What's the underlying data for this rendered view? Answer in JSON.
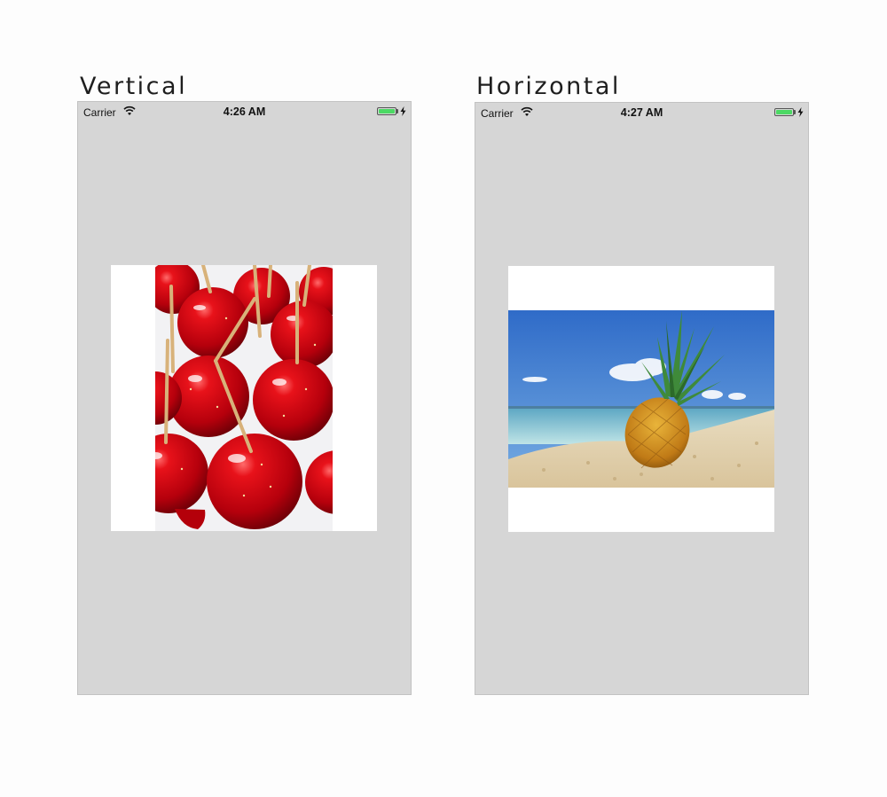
{
  "headings": {
    "vertical": "Vertical",
    "horizontal": "Horizontal"
  },
  "phones": [
    {
      "carrier": "Carrier",
      "time": "4:26 AM",
      "battery_level": 1.0,
      "image": "candy-apples-photo"
    },
    {
      "carrier": "Carrier",
      "time": "4:27 AM",
      "battery_level": 1.0,
      "image": "pineapple-beach-photo"
    }
  ],
  "colors": {
    "screen_background": "#d6d6d6",
    "image_frame": "#ffffff",
    "battery_fill": "#4cd964"
  },
  "icons": [
    "wifi-icon",
    "battery-icon",
    "charging-bolt-icon"
  ]
}
